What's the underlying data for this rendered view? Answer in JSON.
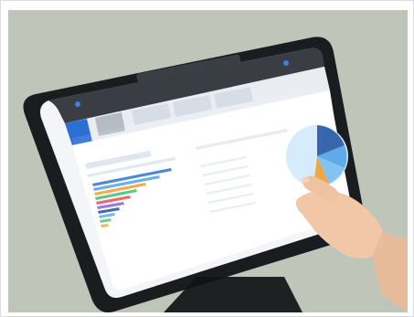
{
  "scene": {
    "description_icon": "photo-of-tablet-dashboard",
    "colors": {
      "background": "#bfc5b8",
      "tablet_frame": "#1b1c1f",
      "screen": "#f3f5f8",
      "safari_bar": "#2a2d33",
      "app_header": "#2b6ed4",
      "accent_blue": "#5aa7e8",
      "pie_dark": "#2f5fa8",
      "pie_light": "#d6ebfb",
      "pie_orange": "#f2a23a",
      "skin": "#f1c7a8"
    }
  },
  "screen_ui": {
    "caption_visible": "",
    "caption_fallback": ""
  }
}
